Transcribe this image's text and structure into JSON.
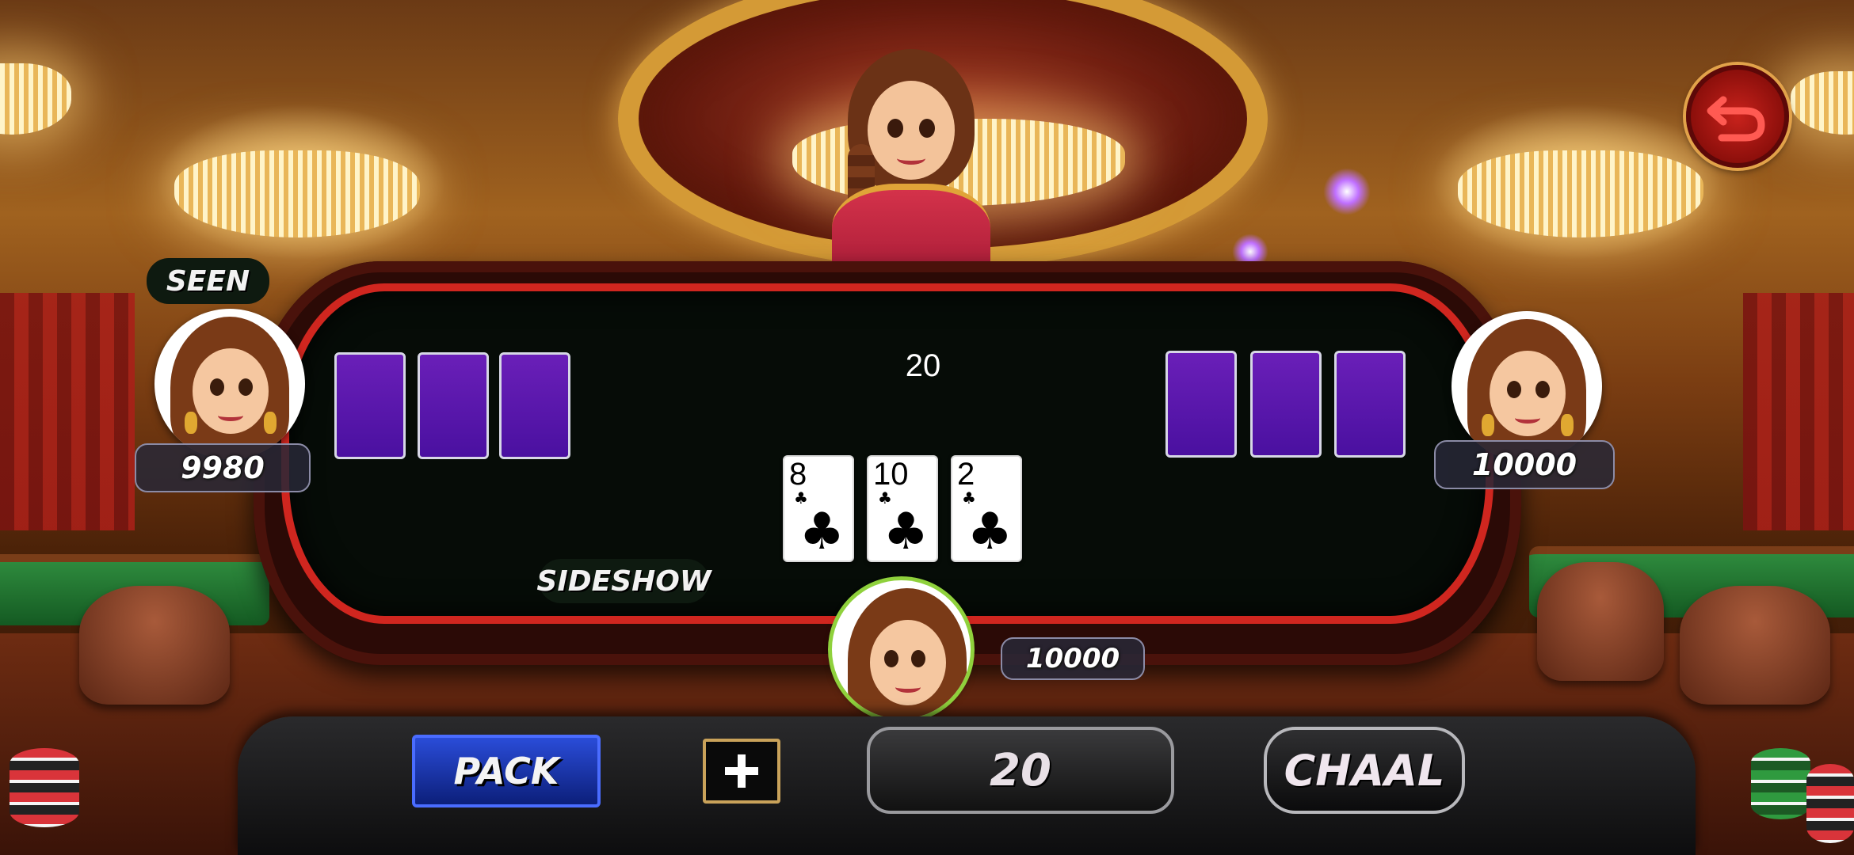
{
  "pot": {
    "amount": "20"
  },
  "players": {
    "left": {
      "status_label": "SEEN",
      "balance": "9980"
    },
    "right": {
      "balance": "10000"
    },
    "self": {
      "balance": "10000",
      "sideshow_label": "SIDESHOW"
    }
  },
  "center_cards": [
    {
      "rank": "8",
      "suit": "♣"
    },
    {
      "rank": "10",
      "suit": "♣"
    },
    {
      "rank": "2",
      "suit": "♣"
    }
  ],
  "controls": {
    "pack_label": "PACK",
    "plus_symbol": "+",
    "bet_amount": "20",
    "chaal_label": "CHAAL"
  },
  "icons": {
    "back": "back-arrow-icon",
    "plus": "plus-icon"
  },
  "colors": {
    "table_felt": "#060c07",
    "table_rim": "#d0261f",
    "card_back": "#5a18ac",
    "pack_button": "#1c36b0"
  }
}
